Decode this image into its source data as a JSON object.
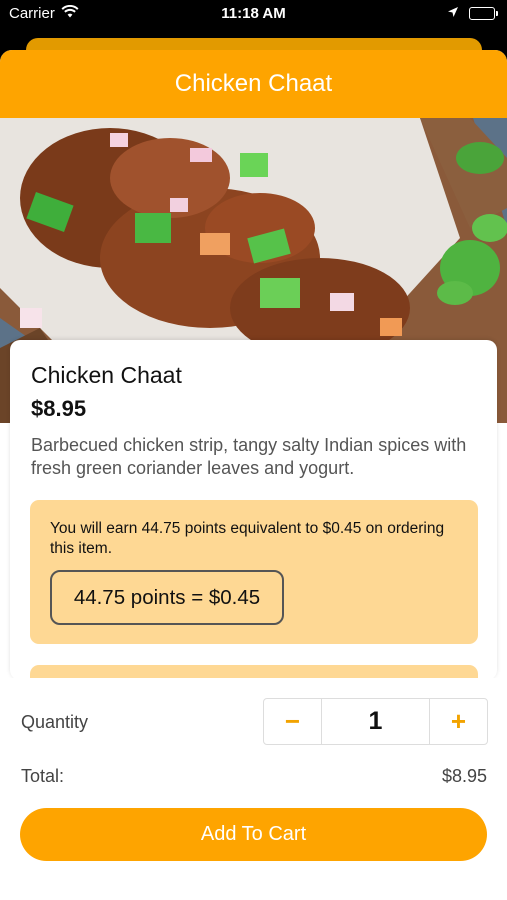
{
  "status_bar": {
    "carrier": "Carrier",
    "time": "11:18 AM",
    "icons": [
      "wifi-icon",
      "location-arrow-icon",
      "battery-icon"
    ]
  },
  "nav": {
    "title": "Chicken Chaat"
  },
  "item": {
    "name": "Chicken Chaat",
    "price": "$8.95",
    "description": "Barbecued chicken strip, tangy salty Indian spices with fresh green coriander leaves and yogurt."
  },
  "points": {
    "message": "You will earn 44.75 points equivalent to $0.45 on ordering this item.",
    "badge": "44.75 points = $0.45"
  },
  "order": {
    "quantity_label": "Quantity",
    "quantity": "1",
    "decrement_symbol": "−",
    "increment_symbol": "+",
    "total_label": "Total:",
    "total_value": "$8.95",
    "add_button_label": "Add To Cart"
  },
  "colors": {
    "accent": "#FEA400",
    "points_background": "#FED894",
    "stepper_symbol": "#F2A300"
  }
}
